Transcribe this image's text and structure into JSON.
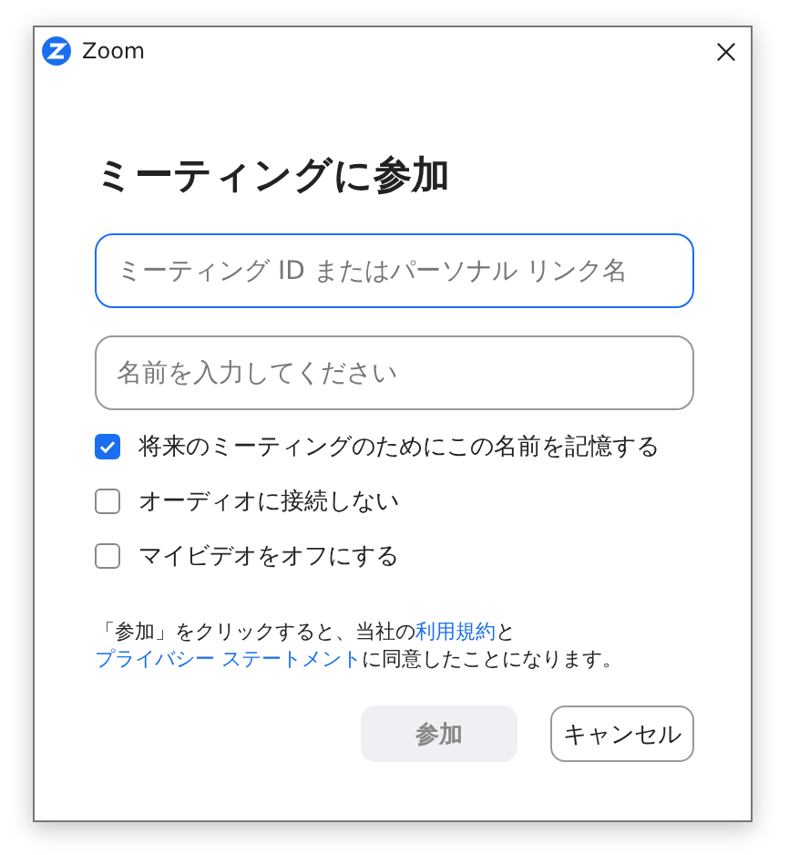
{
  "window": {
    "title": "Zoom"
  },
  "heading": "ミーティングに参加",
  "fields": [
    {
      "placeholder": "ミーティング ID またはパーソナル リンク名",
      "focused": true
    },
    {
      "placeholder": "名前を入力してください",
      "focused": false
    }
  ],
  "options": [
    {
      "label": "将来のミーティングのためにこの名前を記憶する",
      "checked": true
    },
    {
      "label": "オーディオに接続しない",
      "checked": false
    },
    {
      "label": "マイビデオをオフにする",
      "checked": false
    }
  ],
  "consent": [
    {
      "text": "「参加」をクリックすると、当社の",
      "link": false
    },
    {
      "text": "利用規約",
      "link": true
    },
    {
      "text": "と",
      "link": false
    },
    {
      "text": "プライバシー ステートメント",
      "link": true
    },
    {
      "text": "に同意したことになります。",
      "link": false
    }
  ],
  "buttons": [
    {
      "label": "参加",
      "disabled": true
    },
    {
      "label": "キャンセル",
      "disabled": false
    }
  ]
}
